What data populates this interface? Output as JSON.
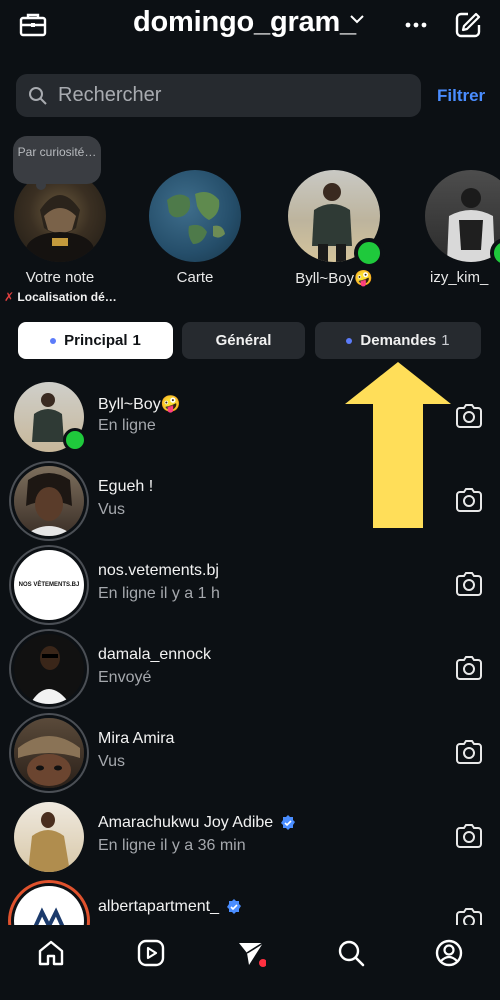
{
  "header": {
    "title": "domingo_gram_"
  },
  "search": {
    "placeholder": "Rechercher",
    "filter_label": "Filtrer"
  },
  "note": {
    "bubble_text": "Par curiosité…",
    "location": "Localisation dé…"
  },
  "stories": [
    {
      "label": "Votre note"
    },
    {
      "label": "Carte"
    },
    {
      "label": "Byll~Boy🤪"
    },
    {
      "label": "izy_kim_"
    }
  ],
  "tabs": [
    {
      "label": "Principal",
      "count": "1"
    },
    {
      "label": "Général"
    },
    {
      "label": "Demandes",
      "count": "1"
    }
  ],
  "conversations": [
    {
      "name": "Byll~Boy🤪",
      "status": "En ligne"
    },
    {
      "name": "Egueh !",
      "status": "Vus"
    },
    {
      "name": "nos.vetements.bj",
      "status": "En ligne il y a 1 h",
      "avatar_text": "NOS VÊTEMENTS.BJ"
    },
    {
      "name": "damala_ennock",
      "status": "Envoyé"
    },
    {
      "name": "Mira Amira",
      "status": "Vus"
    },
    {
      "name": "Amarachukwu Joy Adibe",
      "status": "En ligne il y a 36 min"
    },
    {
      "name": "albertapartment_",
      "status": ""
    }
  ],
  "colors": {
    "accent": "#4a8dff",
    "online": "#1fc93c",
    "arrow": "#ffde59",
    "background": "#0c1014"
  }
}
